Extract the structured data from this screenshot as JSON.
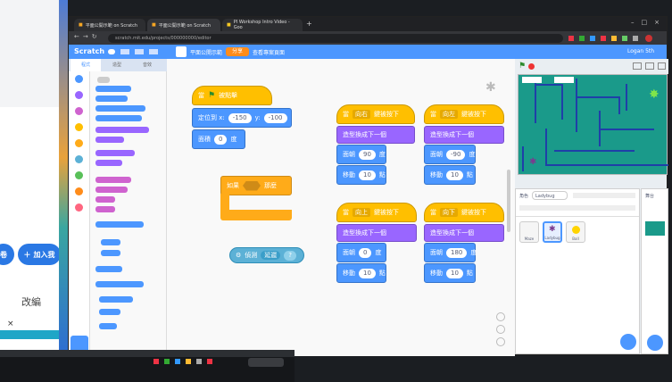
{
  "left_window": {
    "buttons": [
      {
        "label": "卷",
        "color": "#2a78e4"
      },
      {
        "label": "加入我",
        "color": "#2a78e4"
      }
    ],
    "edit_label": "改編",
    "close_label": "×"
  },
  "browser": {
    "tabs": [
      {
        "label": "平面公開示範 on Scratch",
        "active": false
      },
      {
        "label": "平面公開示範 on Scratch",
        "active": true
      },
      {
        "label": "PI Workshop Intro Video - Goo",
        "active": false
      }
    ],
    "url": "scratch.mit.edu/projects/000000000/editor"
  },
  "menubar": {
    "logo": "Scratch",
    "project_title": "平面公開示範",
    "share_label": "分享",
    "see_project_label": "查看專案頁面",
    "user": "Logan 5th"
  },
  "editor_tabs": [
    "程式",
    "造型",
    "音效"
  ],
  "categories": [
    {
      "name": "動作",
      "color": "#4c97ff"
    },
    {
      "name": "外觀",
      "color": "#9966ff"
    },
    {
      "name": "音效",
      "color": "#cf63cf"
    },
    {
      "name": "事件",
      "color": "#ffbf00"
    },
    {
      "name": "控制",
      "color": "#ffab19"
    },
    {
      "name": "偵測",
      "color": "#5cb1d6"
    },
    {
      "name": "運算",
      "color": "#59c059"
    },
    {
      "name": "變數",
      "color": "#ff8c1a"
    },
    {
      "name": "自訂積木",
      "color": "#ff6680"
    }
  ],
  "scripts": {
    "green_flag": {
      "hat": "當",
      "hat_tail": "被點擊",
      "goto_label": "定位到 x:",
      "x": "-150",
      "y_label": "y:",
      "y": "-100",
      "size_label": "面積",
      "size": "0",
      "size_unit": "度"
    },
    "if_block": {
      "label": "如果",
      "then": "那麼"
    },
    "sensing": {
      "label": "偵測",
      "value": "延遲"
    },
    "key_right": {
      "hat": "當",
      "key": "向右",
      "tail": "鍵被按下",
      "switch": "造型換成下一個",
      "turn_label": "面朝",
      "turn": "90",
      "unit": "度",
      "move_label": "移動",
      "move": "10",
      "move_unit": "點"
    },
    "key_left": {
      "hat": "當",
      "key": "向左",
      "tail": "鍵被按下",
      "switch": "造型換成下一個",
      "turn_label": "面朝",
      "turn": "-90",
      "unit": "度",
      "move_label": "移動",
      "move": "10",
      "move_unit": "點"
    },
    "key_up": {
      "hat": "當",
      "key": "向上",
      "tail": "鍵被按下",
      "switch": "造型換成下一個",
      "turn_label": "面朝",
      "turn": "0",
      "unit": "度",
      "move_label": "移動",
      "move": "10",
      "move_unit": "點"
    },
    "key_down": {
      "hat": "當",
      "key": "向下",
      "tail": "鍵被按下",
      "switch": "造型換成下一個",
      "turn_label": "面朝",
      "turn": "180",
      "unit": "度",
      "move_label": "移動",
      "move": "10",
      "move_unit": "點"
    }
  },
  "sprite_panel": {
    "sprite_label": "角色",
    "sprite_name": "Ladybug",
    "sprites": [
      {
        "name": "Maze"
      },
      {
        "name": "Ladybug"
      },
      {
        "name": "Ball"
      }
    ]
  },
  "backdrop_label": "舞台"
}
